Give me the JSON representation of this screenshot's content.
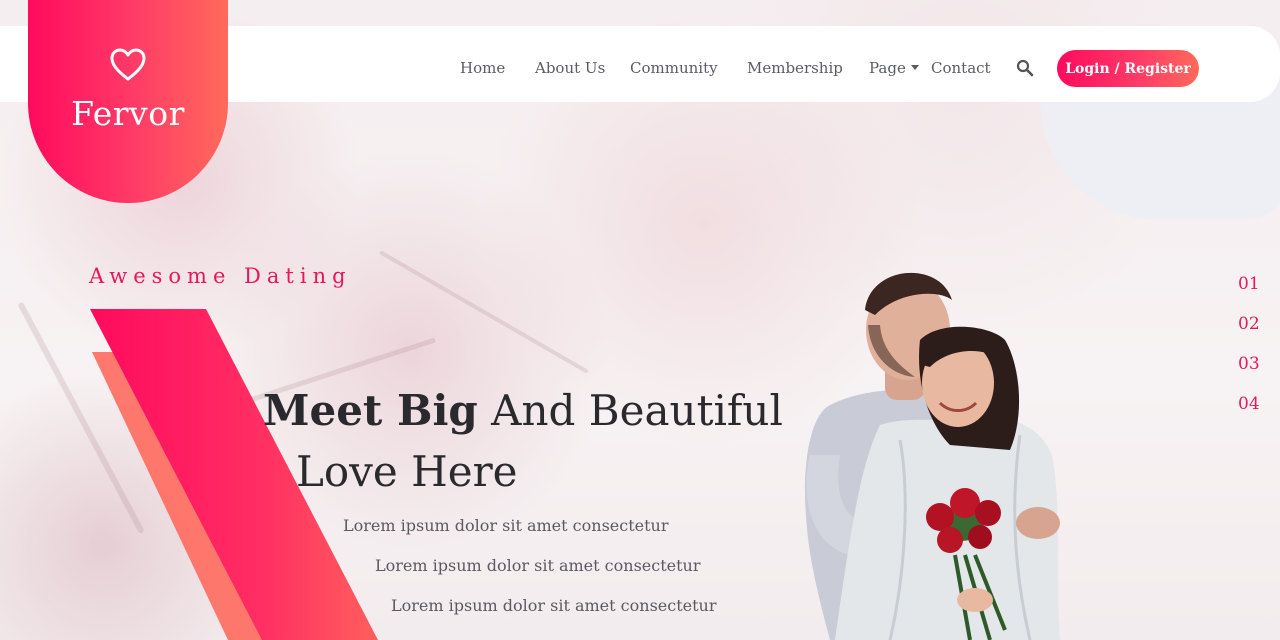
{
  "brand": {
    "name": "Fervor",
    "icon": "heart-icon"
  },
  "nav": {
    "items": [
      {
        "label": "Home"
      },
      {
        "label": "About Us"
      },
      {
        "label": "Community"
      },
      {
        "label": "Membership"
      },
      {
        "label": "Page"
      },
      {
        "label": "Contact"
      }
    ],
    "search_icon": "search-icon",
    "login_label": "Login / Register"
  },
  "hero": {
    "subtitle": "Awesome Dating",
    "headline_bold": "Meet Big",
    "headline_rest": "And Beautiful",
    "headline_line2": "Love Here",
    "lines": [
      "Lorem ipsum dolor sit amet consectetur",
      "Lorem ipsum dolor sit amet consectetur",
      "Lorem ipsum dolor sit amet consectetur"
    ]
  },
  "slider": {
    "numbers": [
      "01",
      "02",
      "03",
      "04"
    ]
  },
  "colors": {
    "accent": "#e8175d",
    "gradient_start": "#ff0a5e",
    "gradient_end": "#ff6a5a"
  }
}
